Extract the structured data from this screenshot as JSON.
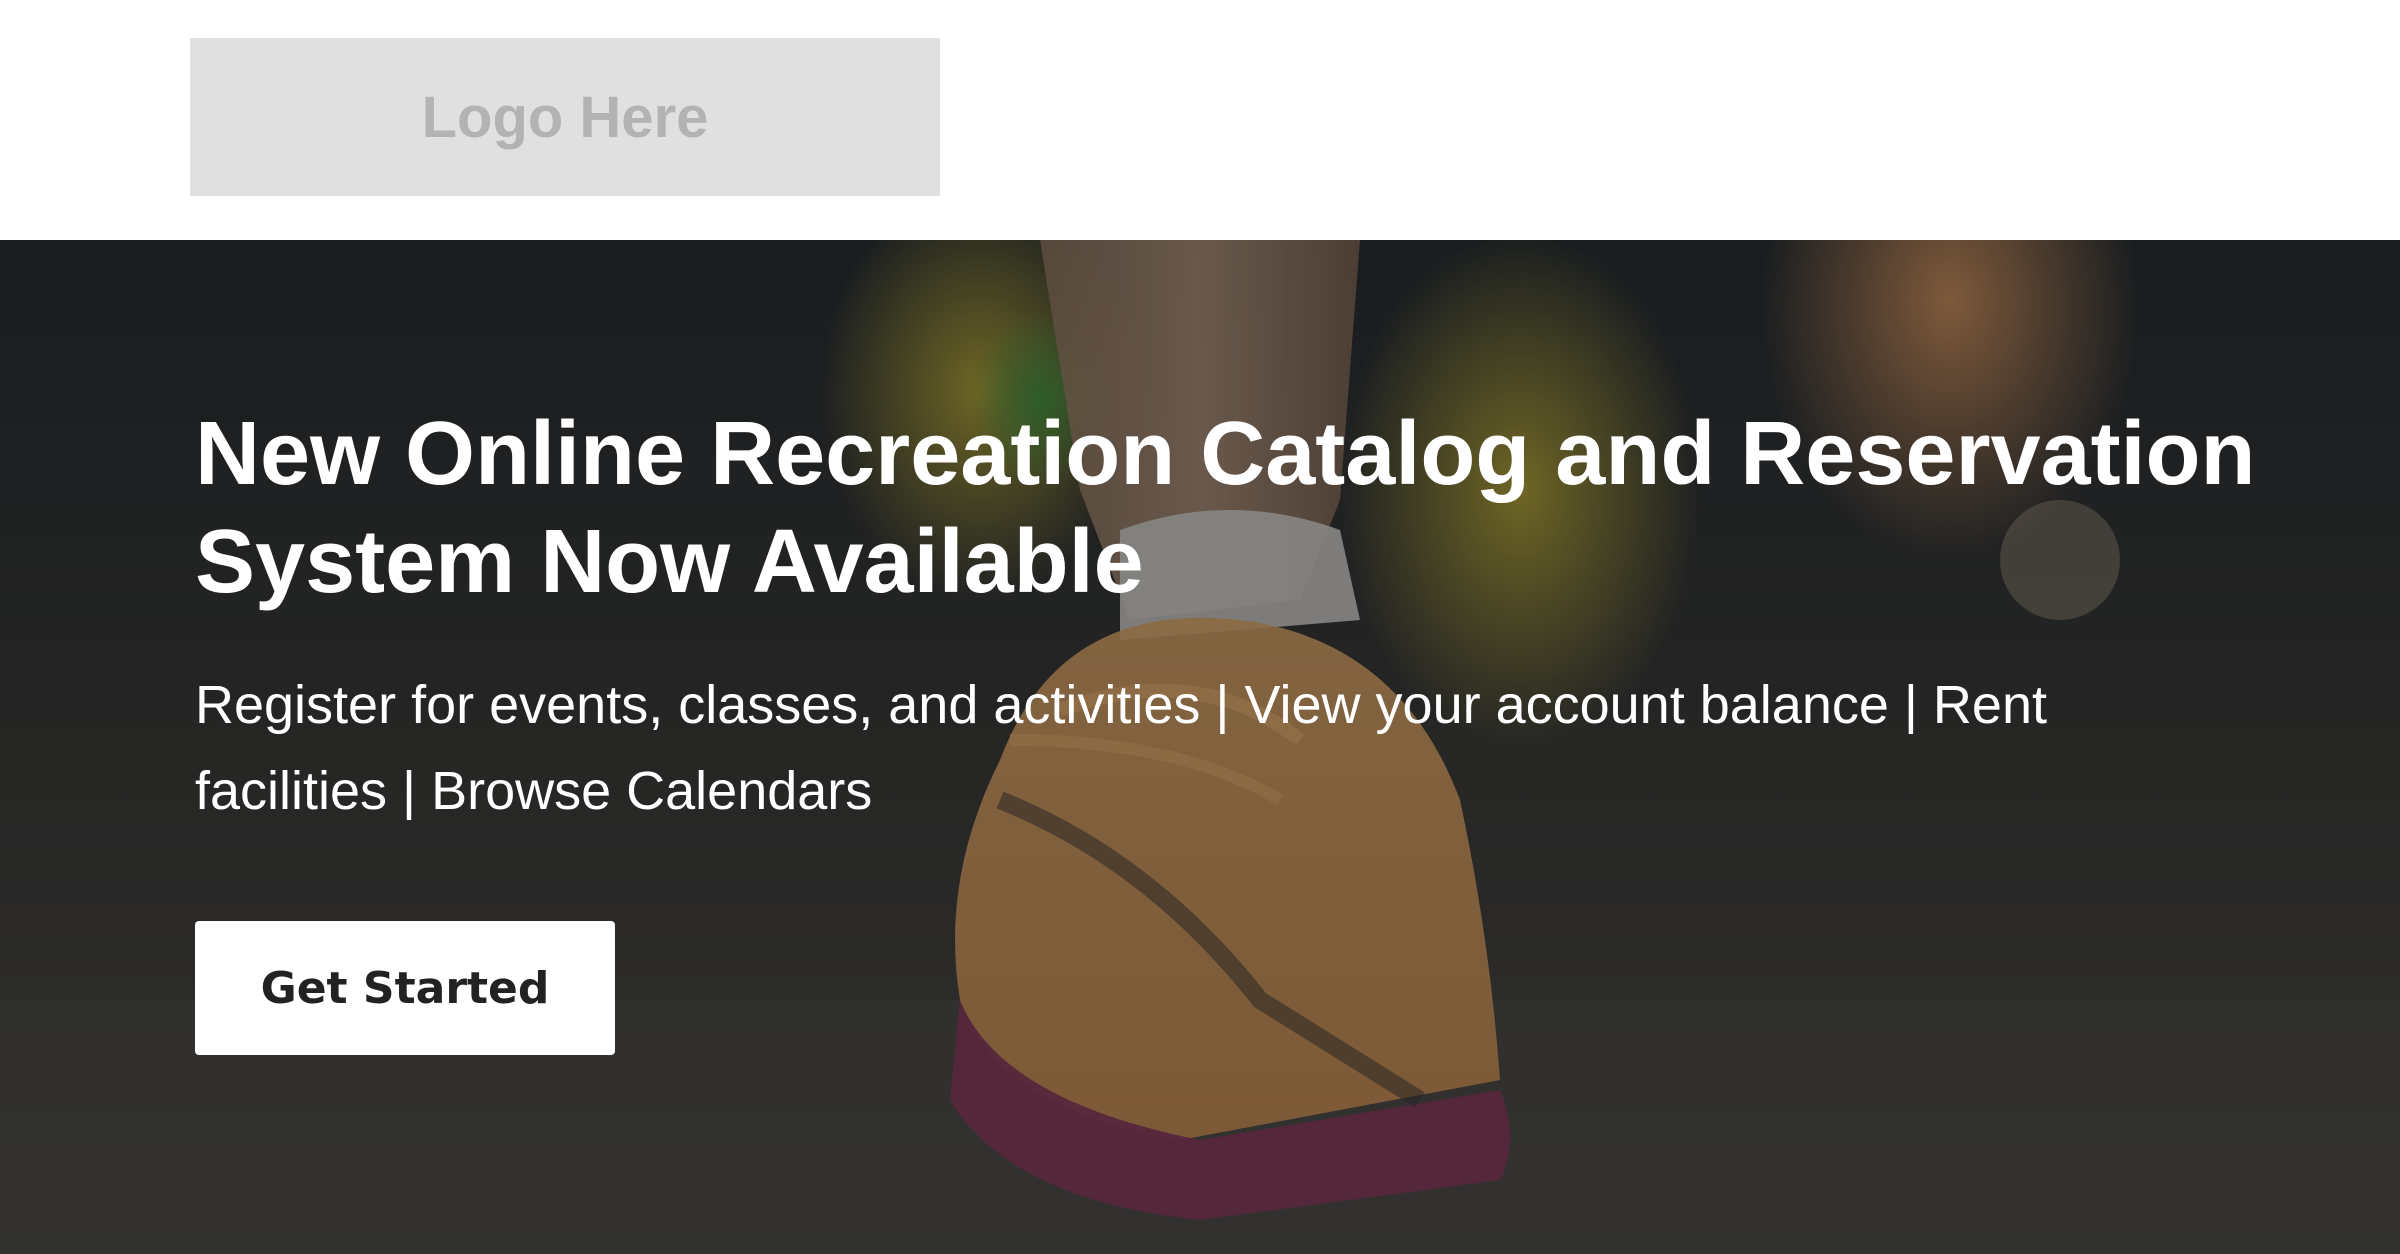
{
  "header": {
    "logo_text": "Logo Here"
  },
  "hero": {
    "title": "New Online Recreation Catalog and Reservation System Now Available",
    "subtitle": "Register for events, classes, and activities | View your account balance | Rent facilities | Browse Calendars",
    "cta_label": "Get Started",
    "background_image": "running-shoes-photo"
  },
  "colors": {
    "logo_placeholder": "#e0e0e0",
    "logo_text": "#b3b3b3",
    "hero_text": "#ffffff",
    "button_bg": "#ffffff",
    "button_text": "#222222"
  }
}
